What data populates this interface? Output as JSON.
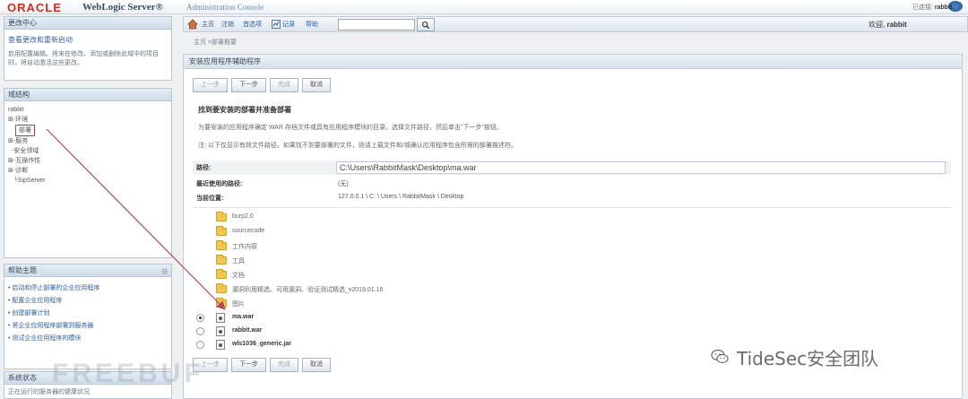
{
  "banner": {
    "logo": "ORACLE",
    "product": "WebLogic Server®",
    "subtitle": "Administration Console"
  },
  "change_center": {
    "title": "更改中心",
    "link": "查看更改和重新启动",
    "text": "启用配置编辑。将来在修改、添加或删除此域中的项目时，将自动激活这些更改。"
  },
  "domain_structure": {
    "title": "域结构",
    "root": "rabbit",
    "items": [
      "环境",
      "部署",
      "服务",
      "安全领域",
      "互操作性",
      "诊断",
      "SipServer"
    ]
  },
  "help_topics": {
    "title": "帮助主题",
    "items": [
      "启动和停止部署的企业应用程序",
      "配置企业应用程序",
      "创建部署计划",
      "将企业应用程序部署到服务器",
      "测试企业应用程序的模块"
    ]
  },
  "system_status": {
    "title": "系统状态",
    "text": "正在运行的服务器的健康状况"
  },
  "toolbar": {
    "links": [
      "主页",
      "注销",
      "首选项",
      "记录",
      "帮助"
    ],
    "search_value": "",
    "welcome_label": "欢迎,",
    "welcome_user": "rabbit",
    "connected_label": "已连接:",
    "connected_user": "rabbit"
  },
  "breadcrumb": "主页 >部署概要",
  "main": {
    "title": "安装应用程序辅助程序",
    "buttons": [
      "上一步",
      "下一步",
      "完成",
      "取消"
    ],
    "heading": "找到要安装的部署并准备部署",
    "intro": "为要安装的应用程序确定 WAR 存档文件或具有应用程序模块的目录。选择文件路径，然后单击\"下一步\"按钮。",
    "note": "注: 以下仅显示有效文件路径。如果找不到要部署的文件，则请上载文件和/或确认应用程序包含所需的部署描述符。",
    "path_label": "路径:",
    "path_value": "C:\\Users\\RabbitMask\\Desktop\\ma.war",
    "recent_label": "最近使用的路径:",
    "recent_value": "(无)",
    "location_label": "当前位置:",
    "location_value": "127.0.0.1 \\ C: \\ Users \\ RabbitMask \\ Desktop",
    "folders": [
      "burp2.0",
      "sourcecode",
      "工作内容",
      "工具",
      "文档",
      "漏洞利用精选、可用漏洞、验证测试精选_v2019.01.16",
      "图片"
    ],
    "files": [
      "ma.war",
      "rabbit.war",
      "wls1036_generic.jar"
    ]
  },
  "watermark": {
    "left": "FREEBUF",
    "right": "TideSec安全团队"
  },
  "colors": {
    "oracle_red": "#d52b1e",
    "link_blue": "#2b62a8",
    "arrow": "#b04a5a"
  }
}
